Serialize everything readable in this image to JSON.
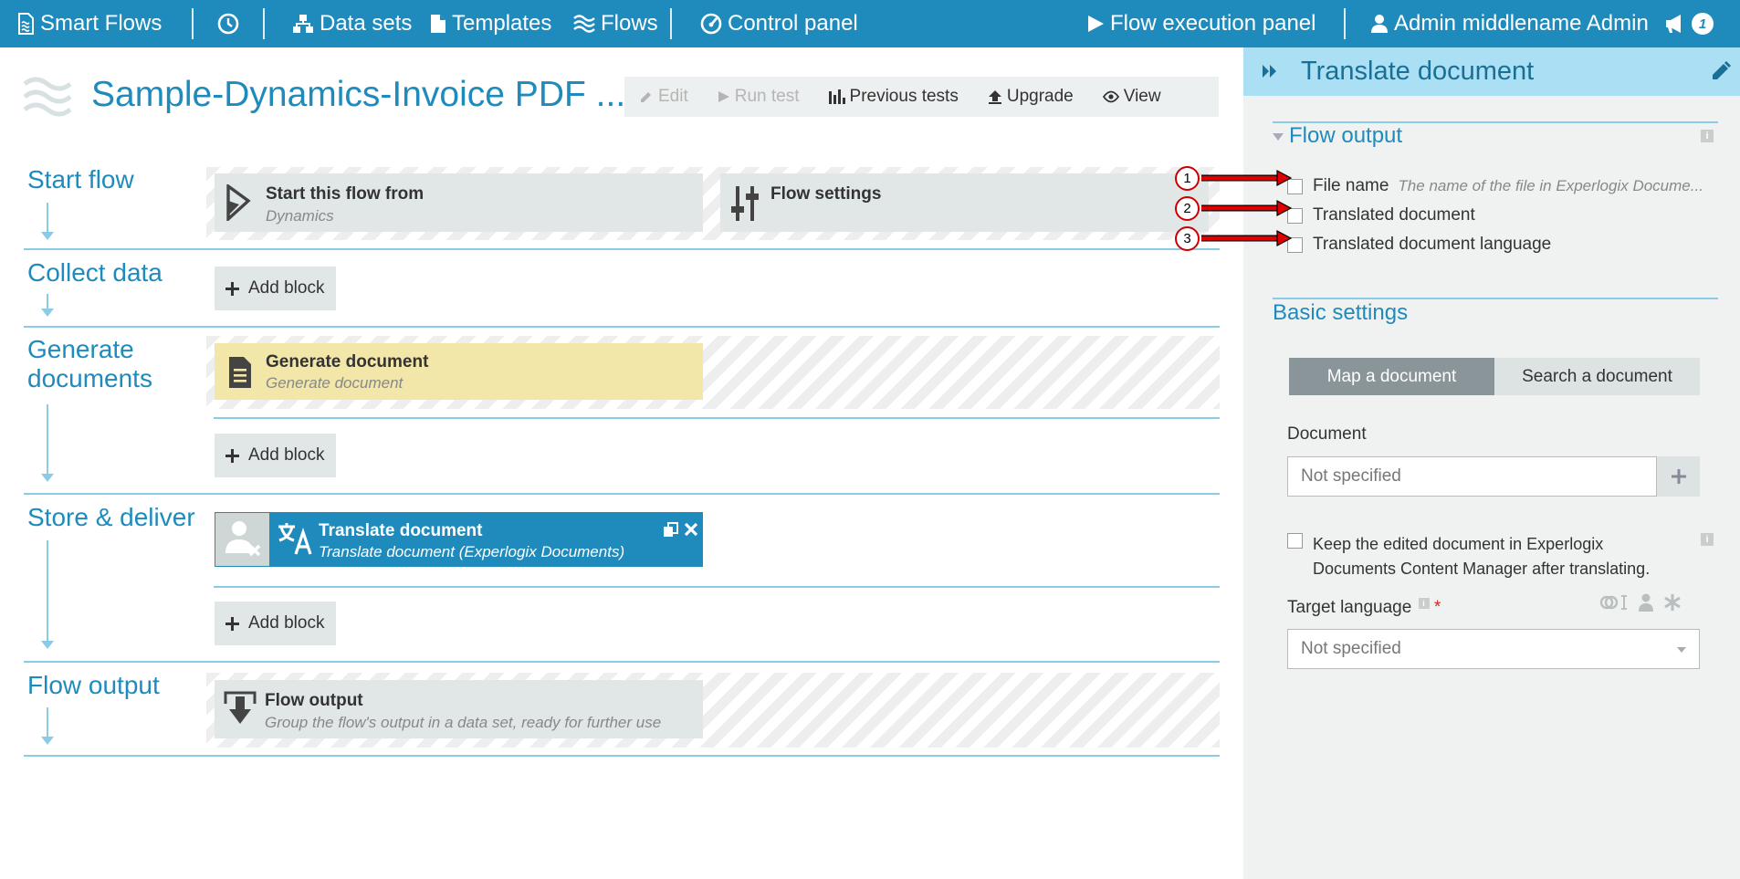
{
  "topbar": {
    "app_name": "Smart Flows",
    "nav": {
      "datasets": "Data sets",
      "templates": "Templates",
      "flows": "Flows",
      "control_panel": "Control panel"
    },
    "flow_execution": "Flow execution panel",
    "user": "Admin middlename Admin",
    "notification_count": "1",
    "color": "#1f8bbd"
  },
  "flow": {
    "title": "Sample-Dynamics-Invoice PDF ...",
    "toolbar": {
      "edit": "Edit",
      "run_test": "Run test",
      "previous_tests": "Previous tests",
      "upgrade": "Upgrade",
      "view": "View"
    }
  },
  "stages": {
    "start": {
      "label": "Start flow",
      "trigger": {
        "title": "Start this flow from",
        "subtitle": "Dynamics"
      },
      "settings": {
        "title": "Flow settings"
      }
    },
    "collect": {
      "label": "Collect data",
      "add": "Add block"
    },
    "generate": {
      "label_line1": "Generate",
      "label_line2": "documents",
      "block": {
        "title": "Generate document",
        "subtitle": "Generate document",
        "color": "#f2e6a8"
      },
      "add": "Add block"
    },
    "store": {
      "label": "Store & deliver",
      "block": {
        "title": "Translate document",
        "subtitle": "Translate document (Experlogix Documents)",
        "color": "#1f8bbd"
      },
      "add": "Add block"
    },
    "output": {
      "label": "Flow output",
      "block": {
        "title": "Flow output",
        "subtitle": "Group the flow's output in a data set, ready for further use"
      }
    }
  },
  "panel": {
    "title": "Translate document",
    "flow_output": {
      "heading": "Flow output",
      "items": [
        {
          "label": "File name",
          "hint": "The name of the file in Experlogix Docume..."
        },
        {
          "label": "Translated document",
          "hint": ""
        },
        {
          "label": "Translated document language",
          "hint": ""
        }
      ]
    },
    "basic_settings": {
      "heading": "Basic settings",
      "tabs": {
        "map": "Map a document",
        "search": "Search a document"
      },
      "document_label": "Document",
      "document_value": "Not specified",
      "keep_line1": "Keep the edited document in Experlogix",
      "keep_line2": "Documents Content Manager after translating.",
      "target_label": "Target language",
      "required_mark": "*",
      "target_value": "Not specified"
    }
  },
  "callouts": [
    "1",
    "2",
    "3"
  ],
  "accent_color": "#1f8bbd",
  "arrow_color": "#e00000"
}
